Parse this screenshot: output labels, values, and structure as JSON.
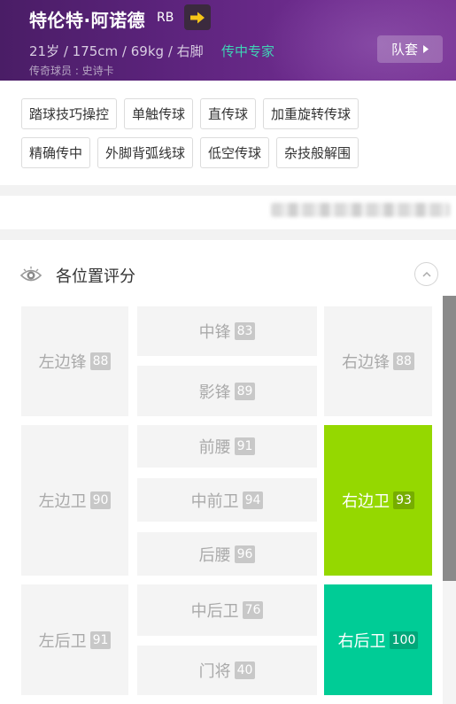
{
  "header": {
    "player_name": "特伦特·阿诺德",
    "position": "RB",
    "info": "21岁 / 175cm / 69kg / 右脚",
    "specialty": "传中专家",
    "legend_label": "传奇球员 : 史诗卡",
    "kit_button": "队套",
    "colors": {
      "background": "#5b237b",
      "specialty": "#3ed5b5",
      "arrow": "#f5c518"
    }
  },
  "skills": {
    "row1": [
      "踏球技巧操控",
      "单触传球",
      "直传球",
      "加重旋转传球"
    ],
    "row2": [
      "精确传中",
      "外脚背弧线球",
      "低空传球",
      "杂技般解围"
    ]
  },
  "ratings": {
    "title": "各位置评分",
    "positions": [
      {
        "name": "左边锋",
        "score": "88"
      },
      {
        "name": "中锋",
        "score": "83"
      },
      {
        "name": "影锋",
        "score": "89"
      },
      {
        "name": "右边锋",
        "score": "88"
      },
      {
        "name": "左边卫",
        "score": "90"
      },
      {
        "name": "前腰",
        "score": "91"
      },
      {
        "name": "中前卫",
        "score": "94"
      },
      {
        "name": "后腰",
        "score": "96"
      },
      {
        "name": "右边卫",
        "score": "93",
        "highlight": "#95d800"
      },
      {
        "name": "左后卫",
        "score": "91"
      },
      {
        "name": "中后卫",
        "score": "76"
      },
      {
        "name": "门将",
        "score": "40"
      },
      {
        "name": "右后卫",
        "score": "100",
        "highlight": "#00cc96"
      }
    ]
  },
  "icons": [
    "arrow-right-icon",
    "caret-right-icon",
    "eye-icon",
    "chevron-up-icon"
  ]
}
